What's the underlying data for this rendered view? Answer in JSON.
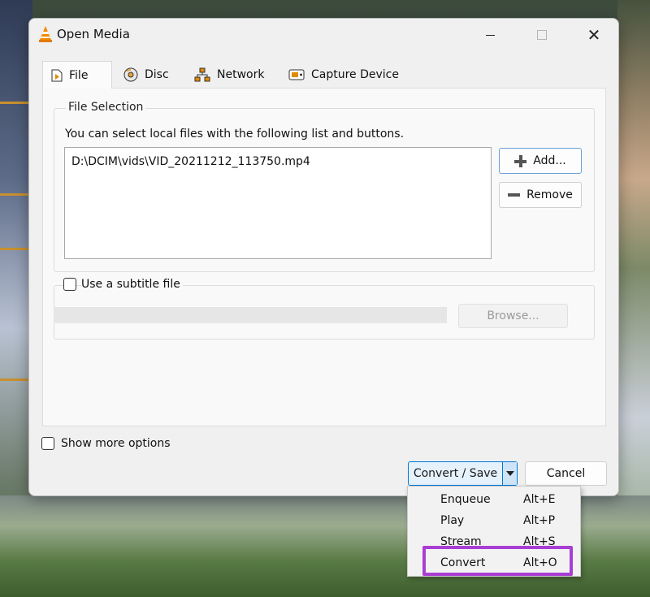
{
  "window": {
    "title": "Open Media",
    "controls": {
      "minimize": "minimize",
      "maximize": "maximize",
      "close": "✕"
    }
  },
  "tabs": [
    {
      "label": "File",
      "icon": "file-play-icon",
      "selected": true
    },
    {
      "label": "Disc",
      "icon": "disc-icon"
    },
    {
      "label": "Network",
      "icon": "network-icon"
    },
    {
      "label": "Capture Device",
      "icon": "capture-device-icon"
    }
  ],
  "file_selection": {
    "legend": "File Selection",
    "description": "You can select local files with the following list and buttons.",
    "files": [
      "D:\\DCIM\\vids\\VID_20211212_113750.mp4"
    ],
    "add_label": "Add...",
    "remove_label": "Remove"
  },
  "subtitle": {
    "checkbox_label": "Use a subtitle file",
    "checked": false,
    "browse_label": "Browse..."
  },
  "show_more_options": {
    "label": "Show more options",
    "checked": false
  },
  "actions": {
    "convert_save_label": "Convert / Save",
    "cancel_label": "Cancel"
  },
  "dropdown_menu": {
    "items": [
      {
        "label": "Enqueue",
        "shortcut": "Alt+E"
      },
      {
        "label": "Play",
        "shortcut": "Alt+P"
      },
      {
        "label": "Stream",
        "shortcut": "Alt+S"
      },
      {
        "label": "Convert",
        "shortcut": "Alt+O"
      }
    ],
    "highlight_color": "#a93ed4"
  },
  "colors": {
    "accent": "#0078d4",
    "dialog_bg": "#f0f0f0"
  }
}
